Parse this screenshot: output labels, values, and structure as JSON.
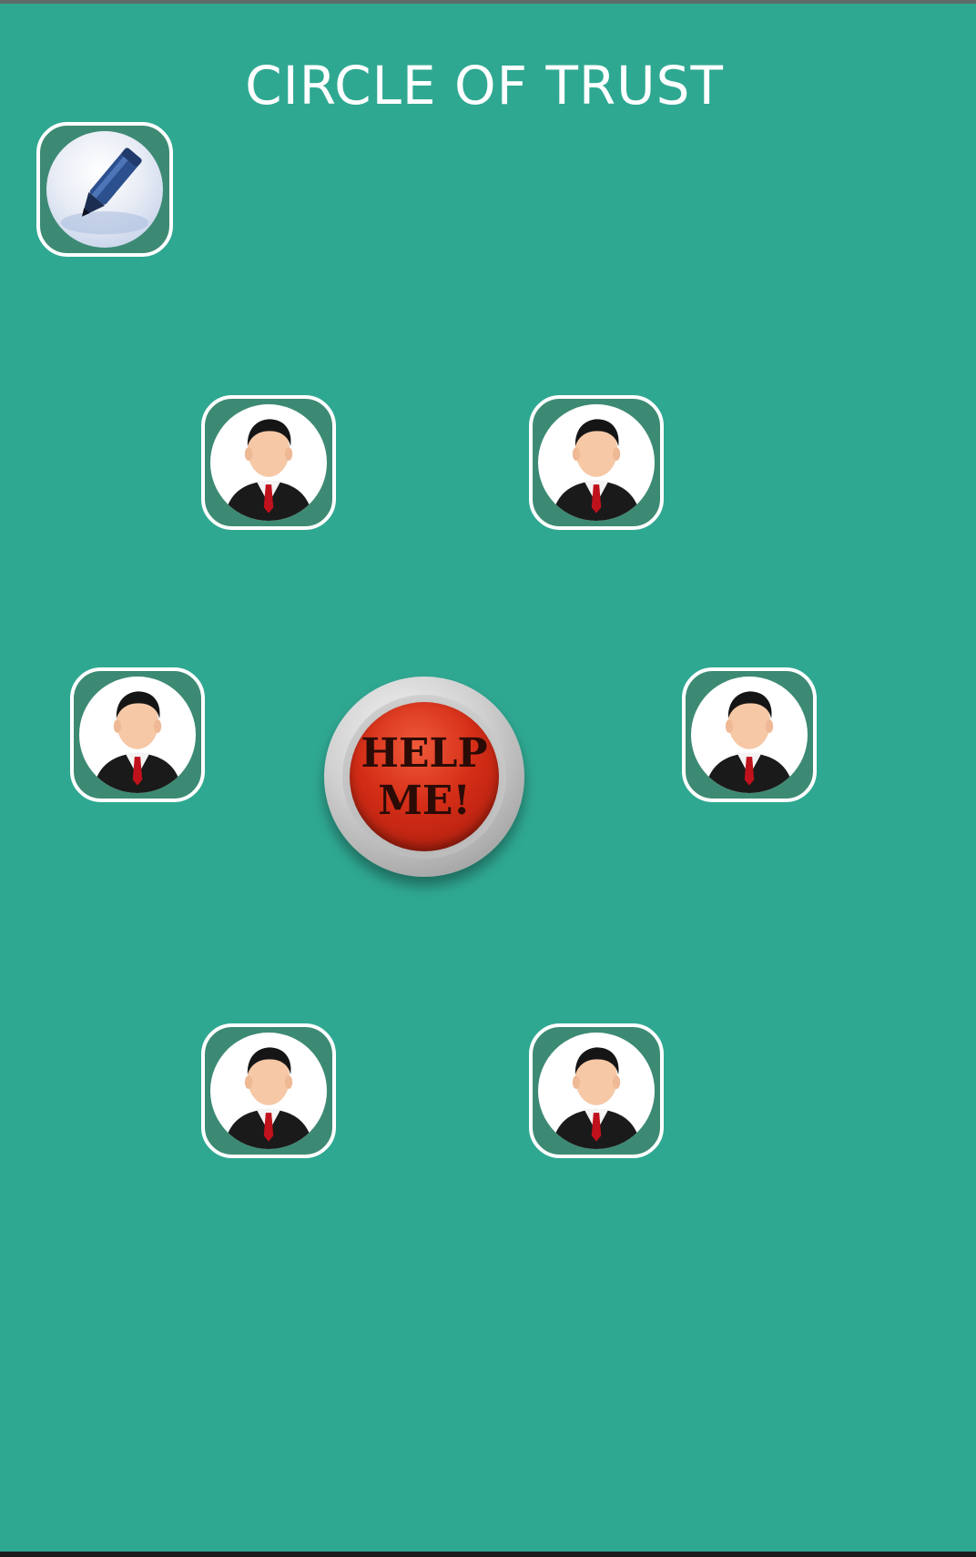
{
  "app": {
    "title": "CIRCLE OF TRUST"
  },
  "actions": {
    "help_line1": "HELP",
    "help_line2": "ME!"
  },
  "contacts": [
    {
      "slot": 1,
      "icon": "person-icon"
    },
    {
      "slot": 2,
      "icon": "person-icon"
    },
    {
      "slot": 3,
      "icon": "person-icon"
    },
    {
      "slot": 4,
      "icon": "person-icon"
    },
    {
      "slot": 5,
      "icon": "person-icon"
    },
    {
      "slot": 6,
      "icon": "person-icon"
    }
  ],
  "edit": {
    "icon": "pencil-icon"
  },
  "colors": {
    "background": "#2fa892",
    "tile_border": "#ffffff",
    "help_red": "#d42d17"
  }
}
